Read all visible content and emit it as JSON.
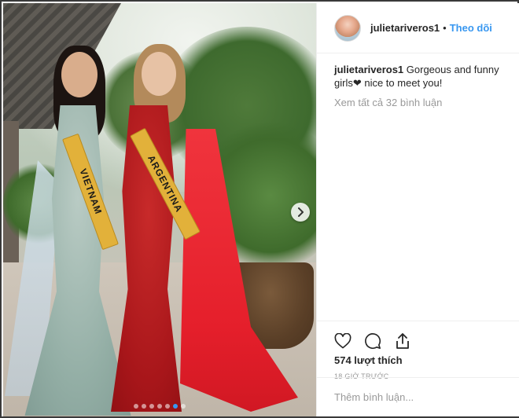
{
  "header": {
    "username": "julietariveros1",
    "separator": "•",
    "follow_label": "Theo dõi"
  },
  "caption": {
    "username": "julietariveros1",
    "text": "Gorgeous and funny girls❤ nice to meet you!"
  },
  "comments": {
    "view_all_label": "Xem tất cả 32 bình luận"
  },
  "photo": {
    "sash_left": "VIETNAM",
    "sash_right": "ARGENTINA",
    "carousel_dots": 7,
    "carousel_active_index": 5
  },
  "actions": {
    "likes": "574 lượt thích",
    "time": "18 giờ trước"
  },
  "add_comment": {
    "placeholder": "Thêm bình luận..."
  },
  "colors": {
    "link_blue": "#3897f0",
    "muted_text": "#999999",
    "border": "#efefef"
  }
}
